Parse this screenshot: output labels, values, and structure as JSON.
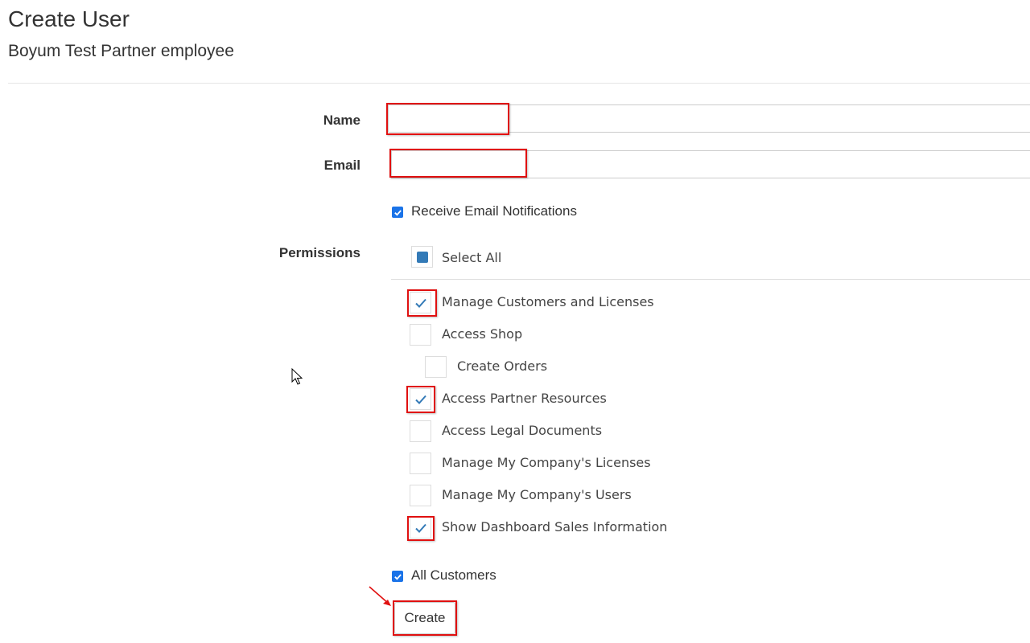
{
  "page": {
    "title": "Create User",
    "subtitle": "Boyum Test Partner employee"
  },
  "form": {
    "name_label": "Name",
    "name_value": "",
    "email_label": "Email",
    "email_value": "",
    "receive_email_notifications": {
      "label": "Receive Email Notifications",
      "checked": true
    },
    "permissions_label": "Permissions",
    "select_all": {
      "label": "Select All",
      "state": "indeterminate"
    },
    "permissions": [
      {
        "label": "Manage Customers and Licenses",
        "checked": true
      },
      {
        "label": "Access Shop",
        "checked": false
      },
      {
        "label": "Create Orders",
        "checked": false,
        "indent": true
      },
      {
        "label": "Access Partner Resources",
        "checked": true
      },
      {
        "label": "Access Legal Documents",
        "checked": false
      },
      {
        "label": "Manage My Company's Licenses",
        "checked": false
      },
      {
        "label": "Manage My Company's Users",
        "checked": false
      },
      {
        "label": "Show Dashboard Sales Information",
        "checked": true
      }
    ],
    "all_customers": {
      "label": "All Customers",
      "checked": true
    },
    "create_button": "Create"
  },
  "colors": {
    "annotation": "#e01010",
    "checkbox_blue": "#1a73e8",
    "check_mark": "#337ab7"
  },
  "icons": {
    "check": "check-icon",
    "cursor": "mouse-pointer-icon",
    "arrow": "annotation-arrow-icon"
  }
}
